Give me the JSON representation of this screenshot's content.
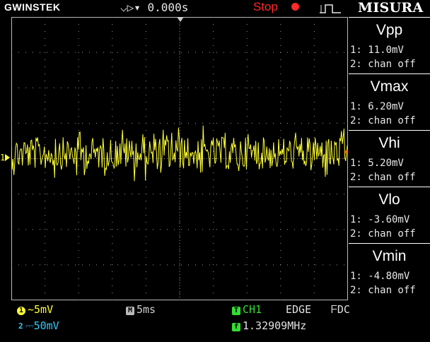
{
  "header": {
    "brand": "GWINSTEK",
    "time_position": "⌵▷▾ 0.000s",
    "run_state": "Stop",
    "panel_title": "MISURA"
  },
  "measurements": [
    {
      "name": "Vpp",
      "line1": "1: 11.0mV",
      "line2": "2: chan off"
    },
    {
      "name": "Vmax",
      "line1": "1: 6.20mV",
      "line2": "2: chan off"
    },
    {
      "name": "Vhi",
      "line1": "1: 5.20mV",
      "line2": "2: chan off"
    },
    {
      "name": "Vlo",
      "line1": "1: -3.60mV",
      "line2": "2: chan off"
    },
    {
      "name": "Vmin",
      "line1": "1: -4.80mV",
      "line2": "2: chan off"
    }
  ],
  "status": {
    "ch1_scale": "~5mV",
    "ch2_scale": "⎓50mV",
    "timebase": "5ms",
    "trigger_source": "CH1",
    "trigger_type": "EDGE",
    "trigger_coupling": "DC",
    "frequency": "1.32909MHz"
  },
  "channel_marker": "1",
  "colors": {
    "ch1": "#ffff33",
    "ch2": "#33ccff",
    "stop": "#ff2a2a",
    "trigger_badge": "#33dd33",
    "grid": "#9a9a9a",
    "trigger_level": "#ff6a00"
  },
  "icons": [
    "ch1-badge",
    "ch2-badge",
    "timebase-badge",
    "trigger-badge",
    "frequency-badge",
    "stop-dot-icon",
    "trigger-edge-icon"
  ]
}
